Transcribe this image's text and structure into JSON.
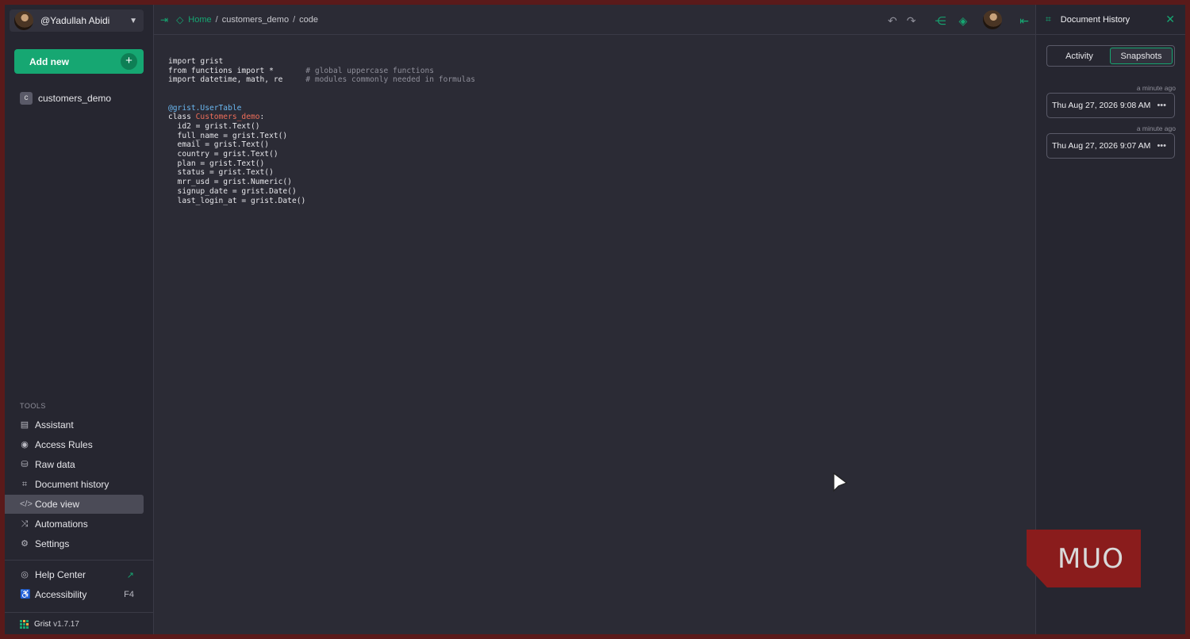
{
  "account": {
    "name": "@Yadullah Abidi"
  },
  "add_new": {
    "label": "Add new"
  },
  "pages": [
    {
      "badge": "c",
      "name": "customers_demo"
    }
  ],
  "tools": {
    "heading": "TOOLS",
    "items": [
      {
        "label": "Assistant",
        "icon": "assistant-icon"
      },
      {
        "label": "Access Rules",
        "icon": "eye-icon"
      },
      {
        "label": "Raw data",
        "icon": "database-icon"
      },
      {
        "label": "Document history",
        "icon": "history-icon"
      },
      {
        "label": "Code view",
        "icon": "code-icon",
        "active": true
      },
      {
        "label": "Automations",
        "icon": "shuffle-icon"
      },
      {
        "label": "Settings",
        "icon": "gear-icon"
      }
    ]
  },
  "help": {
    "help_center": "Help Center",
    "accessibility": "Accessibility",
    "accessibility_shortcut": "F4"
  },
  "version": {
    "app": "Grist",
    "num": "v1.7.17"
  },
  "breadcrumb": {
    "home": "Home",
    "doc": "customers_demo",
    "page": "code"
  },
  "code": {
    "l1": "import grist",
    "l2a": "from functions import *",
    "l2c": "# global uppercase functions",
    "l3a": "import datetime, math, re",
    "l3c": "# modules commonly needed in formulas",
    "decorator": "@grist.UserTable",
    "class_kw": "class ",
    "class_name": "Customers_demo",
    "class_colon": ":",
    "fields": [
      "  id2 = grist.Text()",
      "  full_name = grist.Text()",
      "  email = grist.Text()",
      "  country = grist.Text()",
      "  plan = grist.Text()",
      "  status = grist.Text()",
      "  mrr_usd = grist.Numeric()",
      "  signup_date = grist.Date()",
      "  last_login_at = grist.Date()"
    ]
  },
  "history": {
    "title": "Document History",
    "tab_activity": "Activity",
    "tab_snapshots": "Snapshots",
    "snapshots": [
      {
        "ago": "a minute ago",
        "date": "Thu Aug 27, 2026 9:08 AM"
      },
      {
        "ago": "a minute ago",
        "date": "Thu Aug 27, 2026 9:07 AM"
      }
    ]
  },
  "watermark": "MUO",
  "colors": {
    "accent": "#16a772",
    "background": "#2b2b35",
    "panel": "#262630"
  }
}
